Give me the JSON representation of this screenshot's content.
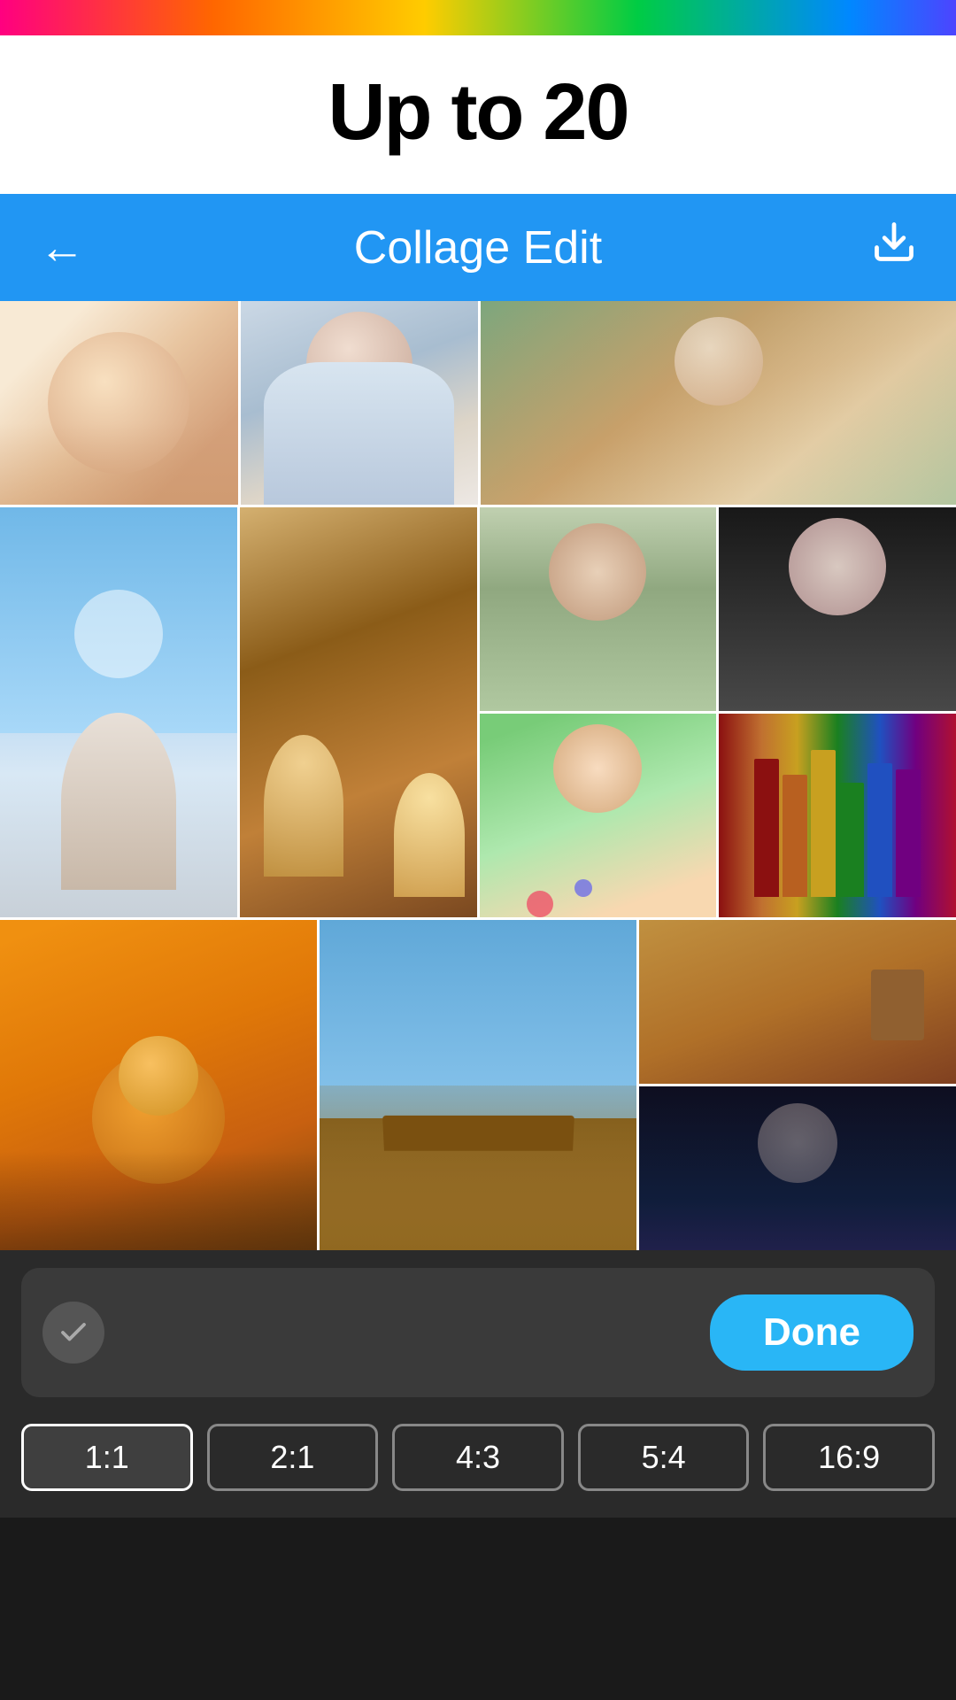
{
  "rainbow_banner": {
    "label": "decorative rainbow banner"
  },
  "title": "Up to 20",
  "header": {
    "back_label": "←",
    "title": "Collage Edit",
    "download_label": "⬇"
  },
  "photos": [
    {
      "id": 1,
      "color": "c-baby",
      "alt": "baby photo"
    },
    {
      "id": 2,
      "color": "c-woman-white",
      "alt": "woman in white dress"
    },
    {
      "id": 3,
      "color": "c-girl-antique",
      "alt": "young girl vintage"
    },
    {
      "id": 4,
      "color": "c-woman-curly",
      "alt": "woman curly hair"
    },
    {
      "id": 5,
      "color": "c-woman-dark",
      "alt": "woman dark background"
    },
    {
      "id": 6,
      "color": "c-sky-girl",
      "alt": "girl with sky background"
    },
    {
      "id": 7,
      "color": "c-cartoon-duo",
      "alt": "cartoon characters"
    },
    {
      "id": 8,
      "color": "c-girl-paint",
      "alt": "girl with paint"
    },
    {
      "id": 9,
      "color": "c-books",
      "alt": "music books"
    },
    {
      "id": 10,
      "color": "c-lion",
      "alt": "lion king"
    },
    {
      "id": 11,
      "color": "c-temple",
      "alt": "chinese temple"
    },
    {
      "id": 12,
      "color": "c-desert",
      "alt": "desert scene"
    },
    {
      "id": 13,
      "color": "c-dark-girl",
      "alt": "dark fantasy girl"
    }
  ],
  "bottom": {
    "done_label": "Done",
    "check_icon": "✓"
  },
  "aspect_ratios": [
    {
      "label": "1:1",
      "active": true
    },
    {
      "label": "2:1",
      "active": false
    },
    {
      "label": "4:3",
      "active": false
    },
    {
      "label": "5:4",
      "active": false
    },
    {
      "label": "16:9",
      "active": false
    }
  ]
}
